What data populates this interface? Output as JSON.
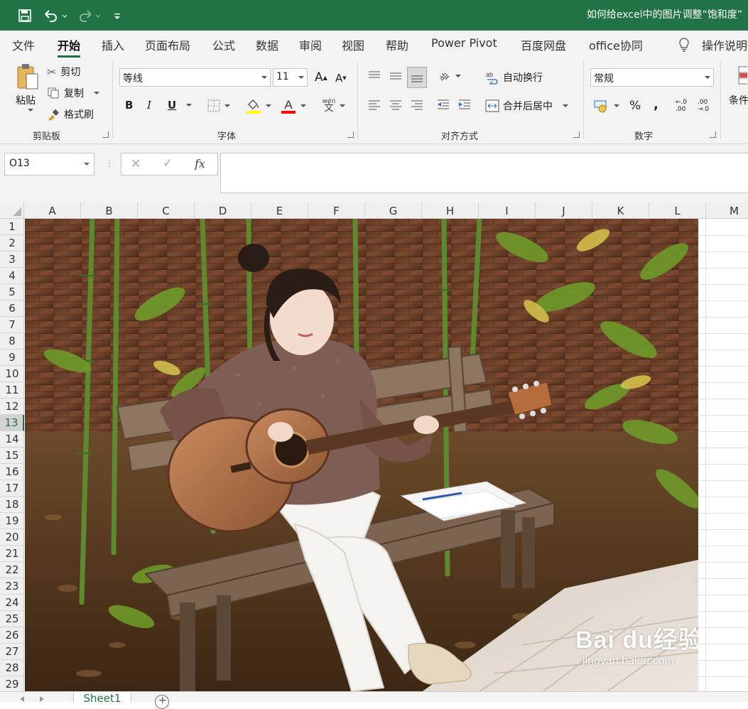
{
  "window": {
    "title": "如何给excel中的图片调整“饱和度”"
  },
  "quick_access": {
    "save_icon": "save-icon",
    "undo_icon": "undo-icon",
    "redo_icon": "redo-icon",
    "customize_icon": "customize-icon"
  },
  "menu": {
    "tabs": [
      {
        "label": "文件"
      },
      {
        "label": "开始"
      },
      {
        "label": "插入"
      },
      {
        "label": "页面布局"
      },
      {
        "label": "公式"
      },
      {
        "label": "数据"
      },
      {
        "label": "审阅"
      },
      {
        "label": "视图"
      },
      {
        "label": "帮助"
      },
      {
        "label": "Power Pivot"
      },
      {
        "label": "百度网盘"
      },
      {
        "label": "office协同"
      },
      {
        "label": "操作说明"
      }
    ],
    "active_tab": "开始"
  },
  "ribbon": {
    "clipboard": {
      "group_label": "剪贴板",
      "paste_label": "粘贴",
      "cut_label": "剪切",
      "copy_label": "复制",
      "format_painter_label": "格式刷"
    },
    "font": {
      "group_label": "字体",
      "font_name": "等线",
      "font_size": "11",
      "bold": "B",
      "italic": "I",
      "underline": "U",
      "fill_color": "#ffff00",
      "font_color": "#ff0000",
      "font_color_glyph": "A",
      "increase_font_glyph": "A",
      "decrease_font_glyph": "A",
      "phonetic_glyph": "wén"
    },
    "alignment": {
      "group_label": "对齐方式",
      "wrap_text_label": "自动换行",
      "merge_center_label": "合并后居中"
    },
    "number": {
      "group_label": "数字",
      "format": "常规",
      "percent": "%",
      "comma": ",",
      "inc_decimal": "←.0 .00",
      "dec_decimal": ".00 →.0"
    },
    "styles": {
      "cond_format_label": "条件"
    }
  },
  "formula_bar": {
    "name_box": "O13",
    "cancel_glyph": "✕",
    "enter_glyph": "✓",
    "fx_glyph": "fx",
    "value": ""
  },
  "sheet": {
    "columns": [
      "A",
      "B",
      "C",
      "D",
      "E",
      "F",
      "G",
      "H",
      "I",
      "J",
      "K",
      "L",
      "M"
    ],
    "rows": [
      "1",
      "2",
      "3",
      "4",
      "5",
      "6",
      "7",
      "8",
      "9",
      "10",
      "11",
      "12",
      "13",
      "14",
      "15",
      "16",
      "17",
      "18",
      "19",
      "20",
      "21",
      "22",
      "23",
      "24",
      "25",
      "26",
      "27",
      "28",
      "29"
    ],
    "selected_row": "13",
    "tabs": [
      {
        "label": "Sheet1"
      }
    ],
    "add_sheet_glyph": "+"
  },
  "watermark": {
    "text_top": "Bai du经验",
    "text_bottom": "jingyan.baidu.com"
  },
  "colors": {
    "excel_green": "#217346",
    "ribbon_bg": "#f3f3f3"
  }
}
